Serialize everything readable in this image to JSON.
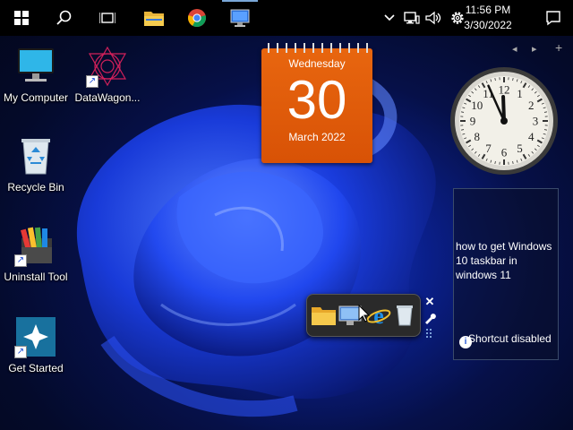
{
  "taskbar": {
    "items": [
      {
        "icon": "windows-start-icon"
      },
      {
        "icon": "search-icon"
      },
      {
        "icon": "task-view-icon"
      },
      {
        "icon": "file-explorer-icon"
      },
      {
        "icon": "chrome-icon"
      },
      {
        "icon": "app-monitor-icon",
        "active": true
      }
    ],
    "tray": {
      "time": "11:56 PM",
      "date": "3/30/2022",
      "icons": [
        "chevron-up-icon",
        "network-icon",
        "volume-icon",
        "settings-gear-icon",
        "notifications-icon"
      ]
    }
  },
  "desktop": {
    "icons": [
      {
        "label": "My Computer",
        "icon": "monitor-icon",
        "shortcut": false
      },
      {
        "label": "DataWagon...",
        "icon": "datawagon-icon",
        "shortcut": true
      },
      {
        "label": "Recycle Bin",
        "icon": "recycle-bin-icon",
        "shortcut": false
      },
      {
        "label": "Uninstall Tool",
        "icon": "uninstall-tool-icon",
        "shortcut": true
      },
      {
        "label": "Get Started",
        "icon": "get-started-icon",
        "shortcut": true
      }
    ]
  },
  "calendar_gadget": {
    "weekday": "Wednesday",
    "day": "30",
    "month_year": "March 2022",
    "color": "#e8660f"
  },
  "clock_gadget": {
    "hour": 11,
    "minute": 56,
    "numerals": [
      "12",
      "1",
      "2",
      "3",
      "4",
      "5",
      "6",
      "7",
      "8",
      "9",
      "10",
      "11"
    ]
  },
  "gadget_controls": {
    "prev": "◂",
    "next": "▸",
    "add": "+"
  },
  "feed_gadget": {
    "text": "how to get Windows 10 taskbar in windows 11",
    "note": "Shortcut disabled"
  },
  "launcher": {
    "items": [
      "folder-icon",
      "network-computer-icon",
      "internet-explorer-icon",
      "recycle-bin-icon"
    ],
    "close": "✕"
  }
}
